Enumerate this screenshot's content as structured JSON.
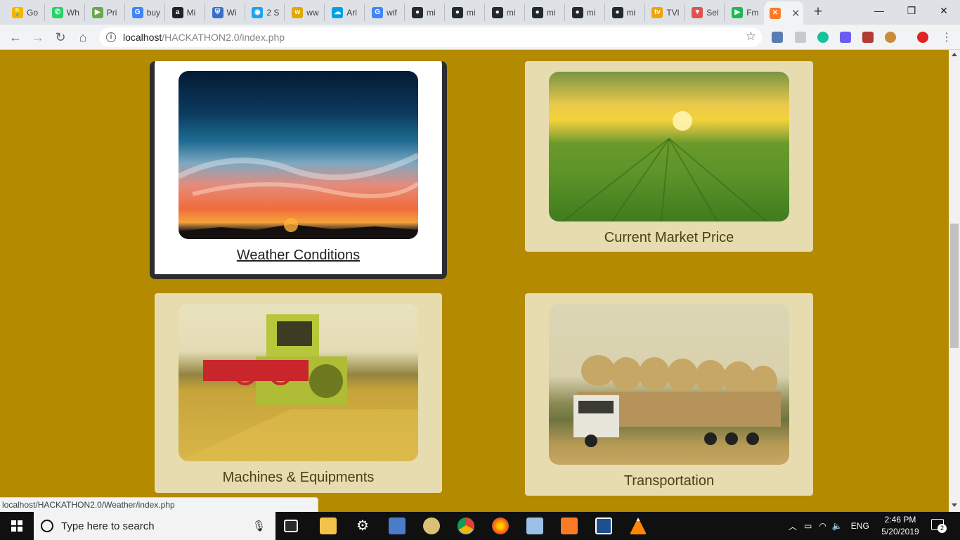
{
  "browser": {
    "tabs": [
      {
        "label": "Go",
        "icon": "keep-icon",
        "color": "#f4b400",
        "glyph": "💡"
      },
      {
        "label": "Wh",
        "icon": "whatsapp-icon",
        "color": "#25d366",
        "glyph": "✆"
      },
      {
        "label": "Pri",
        "icon": "play-icon",
        "color": "#6aa84f",
        "glyph": "▶"
      },
      {
        "label": "buy",
        "icon": "google-icon",
        "color": "#4285f4",
        "glyph": "G"
      },
      {
        "label": "Mi",
        "icon": "amazon-icon",
        "color": "#222222",
        "glyph": "a"
      },
      {
        "label": "Wi",
        "icon": "shield-icon",
        "color": "#3c6ec8",
        "glyph": "⛨"
      },
      {
        "label": "2 S",
        "icon": "chat-icon",
        "color": "#1da1f2",
        "glyph": "◉"
      },
      {
        "label": "ww",
        "icon": "w-icon",
        "color": "#e0a800",
        "glyph": "w"
      },
      {
        "label": "Arl",
        "icon": "salesforce-icon",
        "color": "#00a1e0",
        "glyph": "☁"
      },
      {
        "label": "wif",
        "icon": "google-icon",
        "color": "#4285f4",
        "glyph": "G"
      },
      {
        "label": "mi",
        "icon": "github-icon",
        "color": "#24292e",
        "glyph": "●"
      },
      {
        "label": "mi",
        "icon": "github-icon",
        "color": "#24292e",
        "glyph": "●"
      },
      {
        "label": "mi",
        "icon": "github-icon",
        "color": "#24292e",
        "glyph": "●"
      },
      {
        "label": "mi",
        "icon": "github-icon",
        "color": "#24292e",
        "glyph": "●"
      },
      {
        "label": "mi",
        "icon": "github-icon",
        "color": "#24292e",
        "glyph": "●"
      },
      {
        "label": "mi",
        "icon": "github-icon",
        "color": "#24292e",
        "glyph": "●"
      },
      {
        "label": "TVl",
        "icon": "tv-icon",
        "color": "#f0a30a",
        "glyph": "tv"
      },
      {
        "label": "Sel",
        "icon": "brave-icon",
        "color": "#e05252",
        "glyph": "▼"
      },
      {
        "label": "Fm",
        "icon": "play-circle-icon",
        "color": "#1db954",
        "glyph": "▶"
      }
    ],
    "active_tab_icon": "xampp-icon",
    "url_host": "localhost",
    "url_path": "/HACKATHON2.0/index.php",
    "status_url": "localhost/HACKATHON2.0/Weather/index.php"
  },
  "cards": [
    {
      "caption": "Weather Conditions",
      "focused": true
    },
    {
      "caption": "Current Market Price",
      "focused": false
    },
    {
      "caption": "Machines & Equipments",
      "focused": false
    },
    {
      "caption": "Transportation",
      "focused": false
    }
  ],
  "taskbar": {
    "search_placeholder": "Type here to search",
    "language": "ENG",
    "time": "2:46 PM",
    "date": "5/20/2019",
    "notification_count": "2"
  },
  "colors": {
    "page_background": "#b38a00",
    "card_background": "#e7dcb0",
    "focused_card_border": "#2d2d2d"
  }
}
